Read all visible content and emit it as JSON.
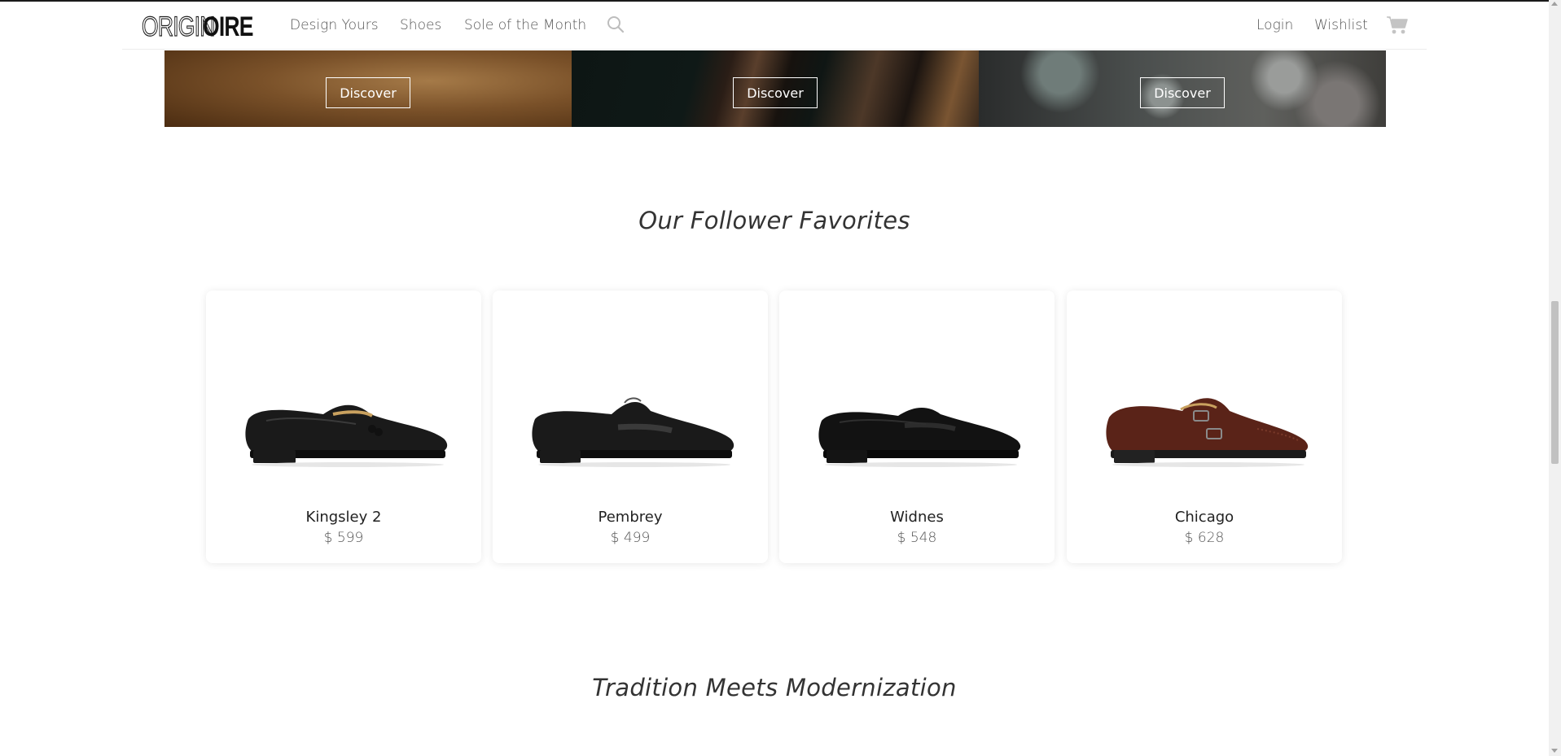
{
  "brand": {
    "logo_light": "ORIGIN",
    "logo_bold": "OIRE"
  },
  "nav": {
    "design_yours": "Design Yours",
    "shoes": "Shoes",
    "sole_of_month": "Sole of the Month",
    "search_icon": "search-icon",
    "login": "Login",
    "wishlist": "Wishlist",
    "cart_icon": "cart-icon"
  },
  "banners": [
    {
      "button": "Discover"
    },
    {
      "button": "Discover"
    },
    {
      "button": "Discover"
    }
  ],
  "favorites": {
    "title": "Our Follower Favorites",
    "products": [
      {
        "name": "Kingsley 2",
        "price": "$ 599",
        "color": "#1a1a1a"
      },
      {
        "name": "Pembrey",
        "price": "$ 499",
        "color": "#1a1a1a"
      },
      {
        "name": "Widnes",
        "price": "$ 548",
        "color": "#121212"
      },
      {
        "name": "Chicago",
        "price": "$ 628",
        "color": "#5a2318"
      }
    ]
  },
  "next_section": {
    "title": "Tradition Meets Modernization"
  }
}
